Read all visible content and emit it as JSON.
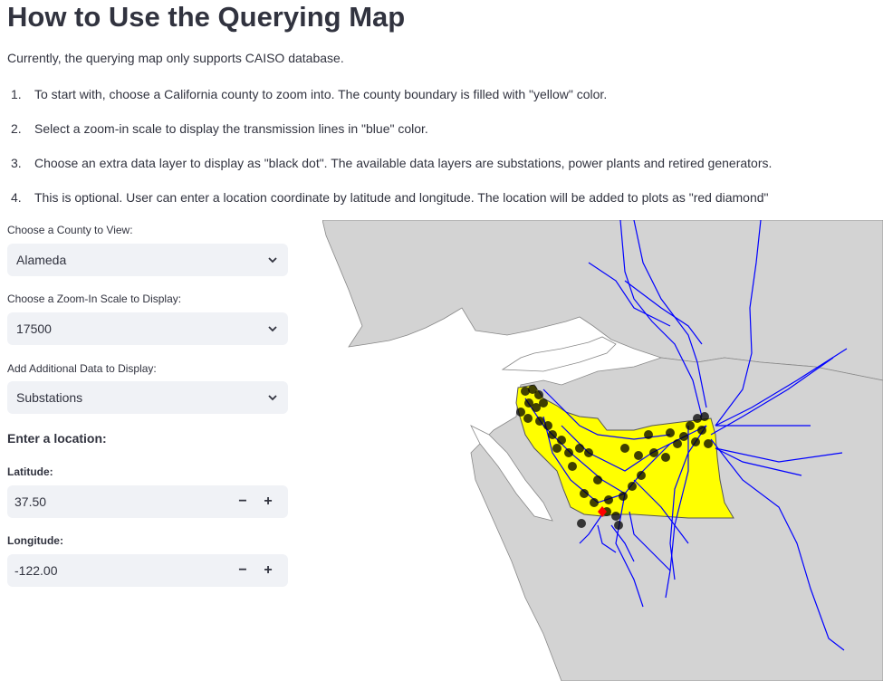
{
  "page": {
    "title": "How to Use the Querying Map",
    "intro": "Currently, the querying map only supports CAISO database.",
    "steps": [
      {
        "num": "1.",
        "text": "To start with, choose a California county to zoom into. The county boundary is filled with \"yellow\" color."
      },
      {
        "num": "2.",
        "text": "Select a zoom-in scale to display the transmission lines in \"blue\" color."
      },
      {
        "num": "3.",
        "text": "Choose an extra data layer to display as \"black dot\". The available data layers are substations, power plants and retired generators."
      },
      {
        "num": "4.",
        "text": "This is optional. User can enter a location coordinate by latitude and longitude. The location will be added to plots as \"red diamond\""
      }
    ]
  },
  "controls": {
    "county": {
      "label": "Choose a County to View:",
      "value": "Alameda"
    },
    "zoom": {
      "label": "Choose a Zoom-In Scale to Display:",
      "value": "17500"
    },
    "layer": {
      "label": "Add Additional Data to Display:",
      "value": "Substations"
    },
    "location_heading": "Enter a location:",
    "latitude": {
      "label": "Latitude:",
      "value": "37.50",
      "minus": "−",
      "plus": "+"
    },
    "longitude": {
      "label": "Longitude:",
      "value": "-122.00",
      "minus": "−",
      "plus": "+"
    }
  },
  "map": {
    "colors": {
      "land": "#d3d3d3",
      "county": "#ffff00",
      "lines": "#0000ff",
      "dots": "#000000",
      "marker": "#ff0000"
    }
  }
}
